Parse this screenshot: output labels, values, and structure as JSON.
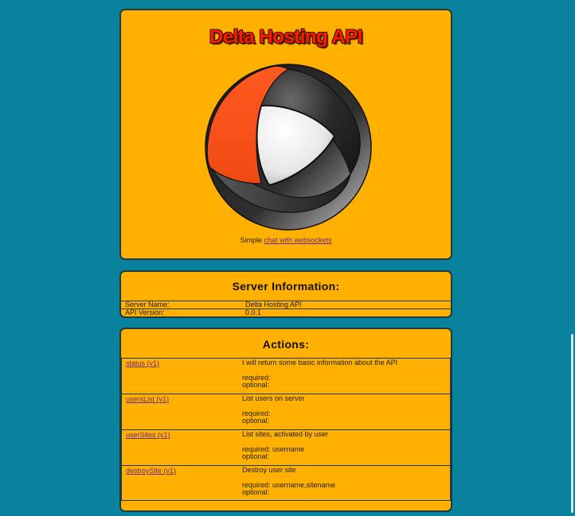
{
  "header": {
    "title": "Delta Hosting API",
    "subtitle_prefix": "Simple ",
    "subtitle_link": "chat with websockets"
  },
  "server_info": {
    "heading": "Server Information:",
    "rows": [
      {
        "key": "Server Name:",
        "value": "Delta Hosting API"
      },
      {
        "key": "API Version:",
        "value": "0.0.1"
      }
    ]
  },
  "actions": {
    "heading": "Actions:",
    "items": [
      {
        "link": "status (v1)",
        "description": "I will return some basic information about the API",
        "required": "required:",
        "optional": "optional:"
      },
      {
        "link": "usersList (v1)",
        "description": "List users on server",
        "required": "required:",
        "optional": "optional:"
      },
      {
        "link": "userSites (v1)",
        "description": "List sites, activated by user",
        "required": "required: username",
        "optional": "optional:"
      },
      {
        "link": "destroySite (v1)",
        "description": "Destroy user site",
        "required": "required: username,sitename",
        "optional": "optional:"
      }
    ]
  },
  "colors": {
    "background": "#09829e",
    "panel": "#ffb000",
    "title": "#ff1a00",
    "link": "#6a2a8a"
  },
  "icons": {
    "logo": "delta-logo-icon"
  }
}
